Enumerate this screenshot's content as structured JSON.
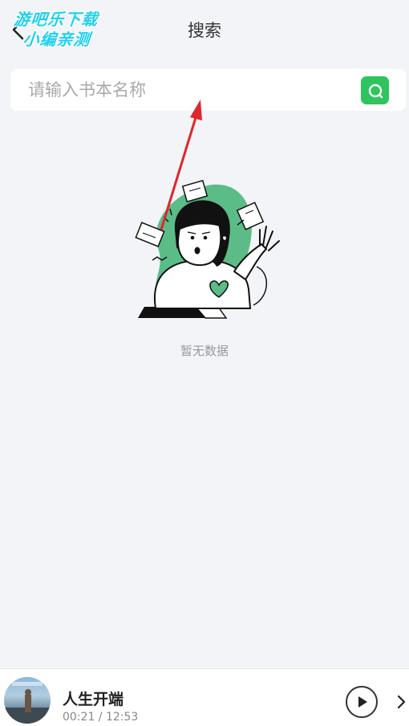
{
  "header": {
    "title": "搜索"
  },
  "watermark": {
    "line1": "游吧乐下载",
    "line2": "小编亲测"
  },
  "search": {
    "placeholder": "请输入书本名称",
    "value": ""
  },
  "empty_state": {
    "text": "暂无数据"
  },
  "player": {
    "title": "人生开端",
    "time": "00:21 / 12:53"
  },
  "colors": {
    "background": "#f3f4f8",
    "accent_green": "#2fc45d",
    "illustration_green": "#5bbc87",
    "arrow_red": "#e0262b",
    "watermark_cyan": "#1fd0ee"
  },
  "icons": [
    "back-icon",
    "search-icon",
    "play-icon",
    "chevron-right-icon"
  ]
}
